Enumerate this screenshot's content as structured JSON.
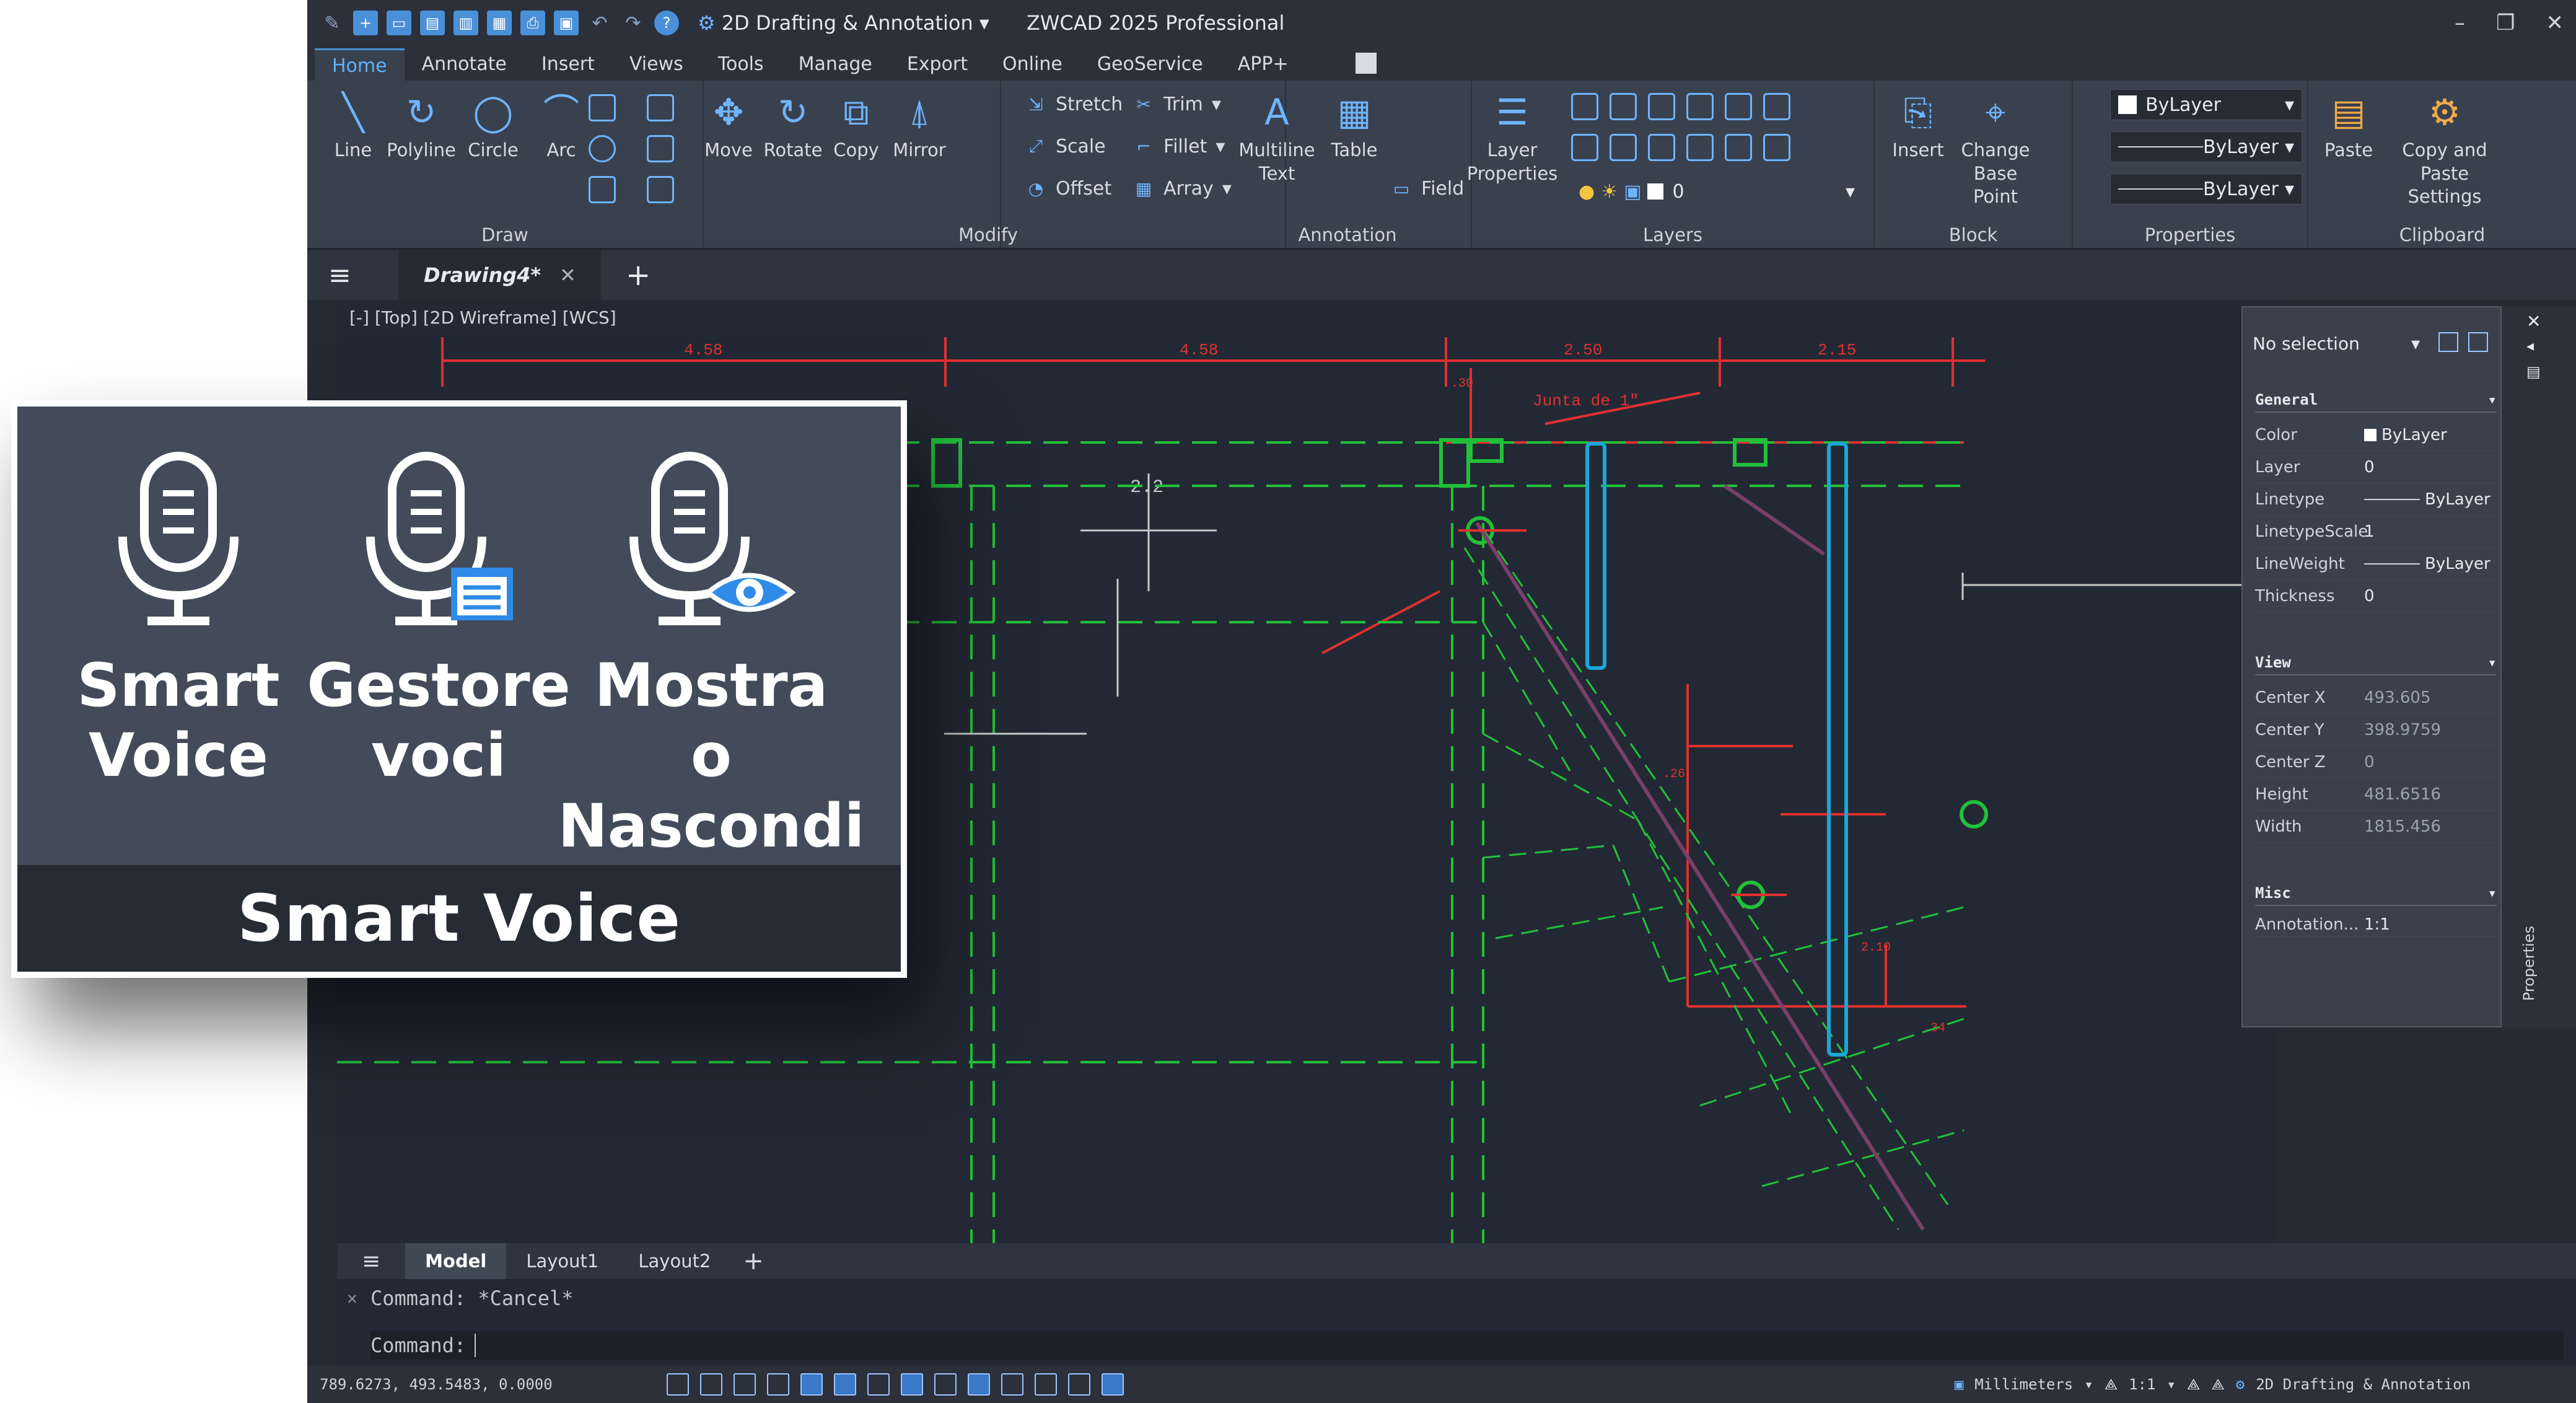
{
  "title_bar": {
    "workspace": "2D Drafting & Annotation",
    "app_title": "ZWCAD 2025 Professional"
  },
  "ribbon_tabs": [
    "Home",
    "Annotate",
    "Insert",
    "Views",
    "Tools",
    "Manage",
    "Export",
    "Online",
    "GeoService",
    "APP+"
  ],
  "ribbon": {
    "draw": {
      "title": "Draw",
      "line": "Line",
      "polyline": "Polyline",
      "circle": "Circle",
      "arc": "Arc"
    },
    "modify": {
      "title": "Modify",
      "move": "Move",
      "rotate": "Rotate",
      "copy": "Copy",
      "mirror": "Mirror",
      "stretch": "Stretch",
      "scale": "Scale",
      "offset": "Offset",
      "trim": "Trim",
      "fillet": "Fillet",
      "array": "Array"
    },
    "annotation": {
      "title": "Annotation",
      "multiline_text_1": "Multiline",
      "multiline_text_2": "Text",
      "table": "Table",
      "field": "Field"
    },
    "layers": {
      "title": "Layers",
      "layer_properties_1": "Layer",
      "layer_properties_2": "Properties",
      "current_layer": "0"
    },
    "block": {
      "title": "Block",
      "insert": "Insert",
      "change_base_point_1": "Change",
      "change_base_point_2": "Base Point"
    },
    "properties": {
      "title": "Properties",
      "color": "ByLayer",
      "linetype": "ByLayer",
      "lineweight": "ByLayer"
    },
    "clipboard": {
      "title": "Clipboard",
      "paste": "Paste",
      "copy_paste_settings_1": "Copy and Paste",
      "copy_paste_settings_2": "Settings"
    }
  },
  "doc_tab": {
    "name": "Drawing4*"
  },
  "viewport_label": "[-] [Top] [2D Wireframe] [WCS]",
  "drawing": {
    "dims": [
      "4.58",
      "4.58",
      "2.50",
      "2.15"
    ],
    "note": "Junta de 1\"",
    "small_labels": [
      ".30",
      "2.2",
      ".26",
      "2.10",
      ".34"
    ]
  },
  "properties_panel": {
    "selection": "No selection",
    "general": {
      "header": "General",
      "rows": [
        {
          "k": "Color",
          "v": "ByLayer"
        },
        {
          "k": "Layer",
          "v": "0"
        },
        {
          "k": "Linetype",
          "v": "ByLayer"
        },
        {
          "k": "LinetypeScale",
          "v": "1"
        },
        {
          "k": "LineWeight",
          "v": "ByLayer"
        },
        {
          "k": "Thickness",
          "v": "0"
        }
      ]
    },
    "view": {
      "header": "View",
      "rows": [
        {
          "k": "Center X",
          "v": "493.605"
        },
        {
          "k": "Center Y",
          "v": "398.9759"
        },
        {
          "k": "Center Z",
          "v": "0"
        },
        {
          "k": "Height",
          "v": "481.6516"
        },
        {
          "k": "Width",
          "v": "1815.456"
        }
      ]
    },
    "misc": {
      "header": "Misc",
      "rows": [
        {
          "k": "Annotation...",
          "v": "1:1"
        }
      ]
    },
    "side_label": "Properties"
  },
  "layout_tabs": [
    "Model",
    "Layout1",
    "Layout2"
  ],
  "command": {
    "history": "Command: *Cancel*",
    "prompt": "Command:"
  },
  "status": {
    "coords": "789.6273, 493.5483, 0.0000",
    "units": "Millimeters",
    "scale": "1:1",
    "workspace": "2D Drafting & Annotation"
  },
  "overlay": {
    "items": [
      {
        "line1": "Smart",
        "line2": "Voice"
      },
      {
        "line1": "Gestore",
        "line2": "voci"
      },
      {
        "line1": "Mostra o",
        "line2": "Nascondi"
      }
    ],
    "title": "Smart Voice"
  },
  "colors": {
    "accent": "#4a90d9",
    "dim_red": "#e03030",
    "green": "#22c03a",
    "cyan": "#1aa7d6"
  }
}
